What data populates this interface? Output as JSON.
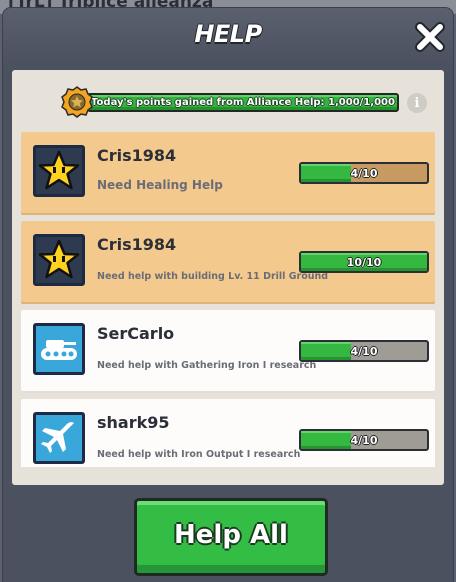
{
  "background": {
    "alliance_title": "[TrL] Triplice alleanza"
  },
  "dialog": {
    "title": "HELP",
    "close_icon": "close-icon"
  },
  "points": {
    "text": "Today's points gained from Alliance Help: 1,000/1,000",
    "medal_icon": "medal-icon",
    "info_icon": "info-icon",
    "info_glyph": "i"
  },
  "requests": [
    {
      "username": "Cris1984",
      "request": "Need Healing Help",
      "progress_text": "4/10",
      "progress": 0.4,
      "avatar_icon": "star-icon",
      "style": "gold"
    },
    {
      "username": "Cris1984",
      "request": "Need help with building Lv. 11 Drill Ground",
      "progress_text": "10/10",
      "progress": 1.0,
      "avatar_icon": "star-icon",
      "style": "gold"
    },
    {
      "username": "SerCarlo",
      "request": "Need help with Gathering Iron I research",
      "progress_text": "4/10",
      "progress": 0.4,
      "avatar_icon": "tank-icon",
      "style": "white"
    },
    {
      "username": "shark95",
      "request": "Need help with Iron Output I research",
      "progress_text": "4/10",
      "progress": 0.4,
      "avatar_icon": "airplane-icon",
      "style": "white"
    }
  ],
  "actions": {
    "help_all_label": "Help All"
  },
  "colors": {
    "accent_green": "#34b840",
    "row_gold": "#f4c98e",
    "row_white": "#fdfcfb",
    "modal_bg": "#4b515e"
  }
}
